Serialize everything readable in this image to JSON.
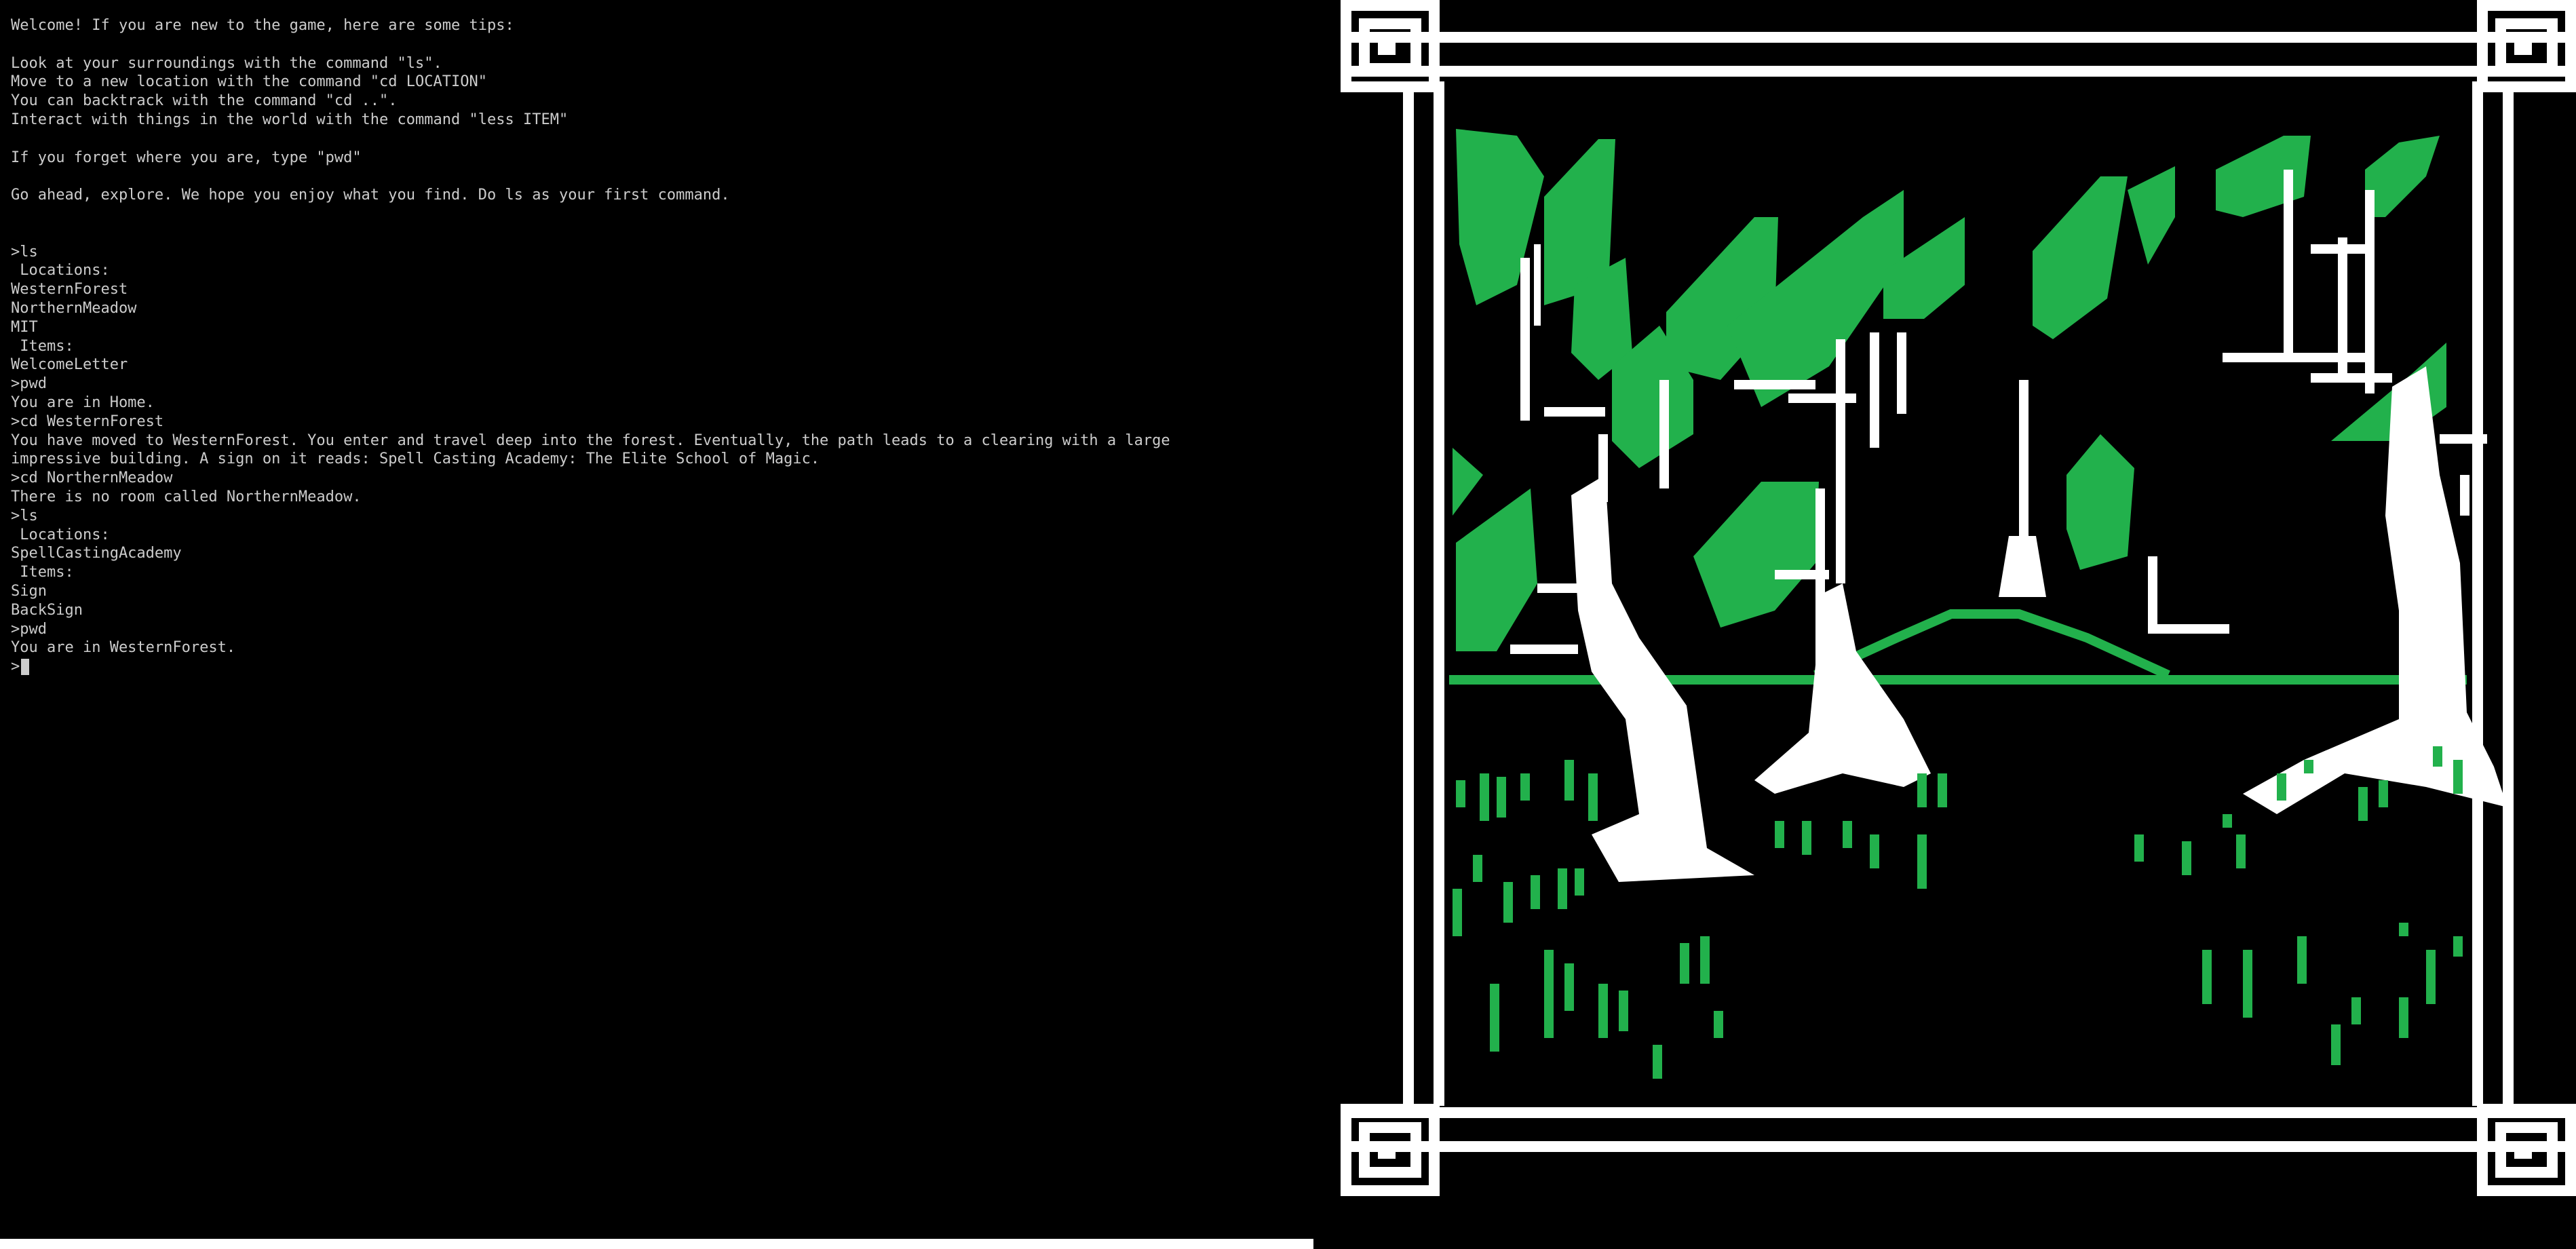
{
  "terminal": {
    "lines": [
      {
        "text": "Welcome! If you are new to the game, here are some tips:"
      },
      {
        "text": ""
      },
      {
        "text": "Look at your surroundings with the command \"ls\"."
      },
      {
        "text": "Move to a new location with the command \"cd LOCATION\""
      },
      {
        "text": "You can backtrack with the command \"cd ..\"."
      },
      {
        "text": "Interact with things in the world with the command \"less ITEM\""
      },
      {
        "text": ""
      },
      {
        "text": "If you forget where you are, type \"pwd\""
      },
      {
        "text": ""
      },
      {
        "text": "Go ahead, explore. We hope you enjoy what you find. Do ls as your first command."
      },
      {
        "text": ""
      },
      {
        "text": ""
      },
      {
        "text": ">ls"
      },
      {
        "text": " Locations:"
      },
      {
        "text": "WesternForest"
      },
      {
        "text": "NorthernMeadow"
      },
      {
        "text": "MIT"
      },
      {
        "text": " Items:"
      },
      {
        "text": "WelcomeLetter"
      },
      {
        "text": ">pwd"
      },
      {
        "text": "You are in Home."
      },
      {
        "text": ">cd WesternForest"
      },
      {
        "text": "You have moved to WesternForest. You enter and travel deep into the forest. Eventually, the path leads to a clearing with a large"
      },
      {
        "text": "impressive building. A sign on it reads: Spell Casting Academy: The Elite School of Magic."
      },
      {
        "text": ">cd NorthernMeadow"
      },
      {
        "text": "There is no room called NorthernMeadow."
      },
      {
        "text": ">ls"
      },
      {
        "text": " Locations:"
      },
      {
        "text": "SpellCastingAcademy"
      },
      {
        "text": " Items:"
      },
      {
        "text": "Sign"
      },
      {
        "text": "BackSign"
      },
      {
        "text": ">pwd"
      },
      {
        "text": "You are in WesternForest."
      }
    ],
    "prompt": ">",
    "input_value": ""
  },
  "scene": {
    "icon": "forest-scene-pixel-art",
    "colors": {
      "leaf": "#22b14c",
      "trunk": "#ffffff",
      "frame": "#ffffff",
      "background": "#000000"
    }
  }
}
